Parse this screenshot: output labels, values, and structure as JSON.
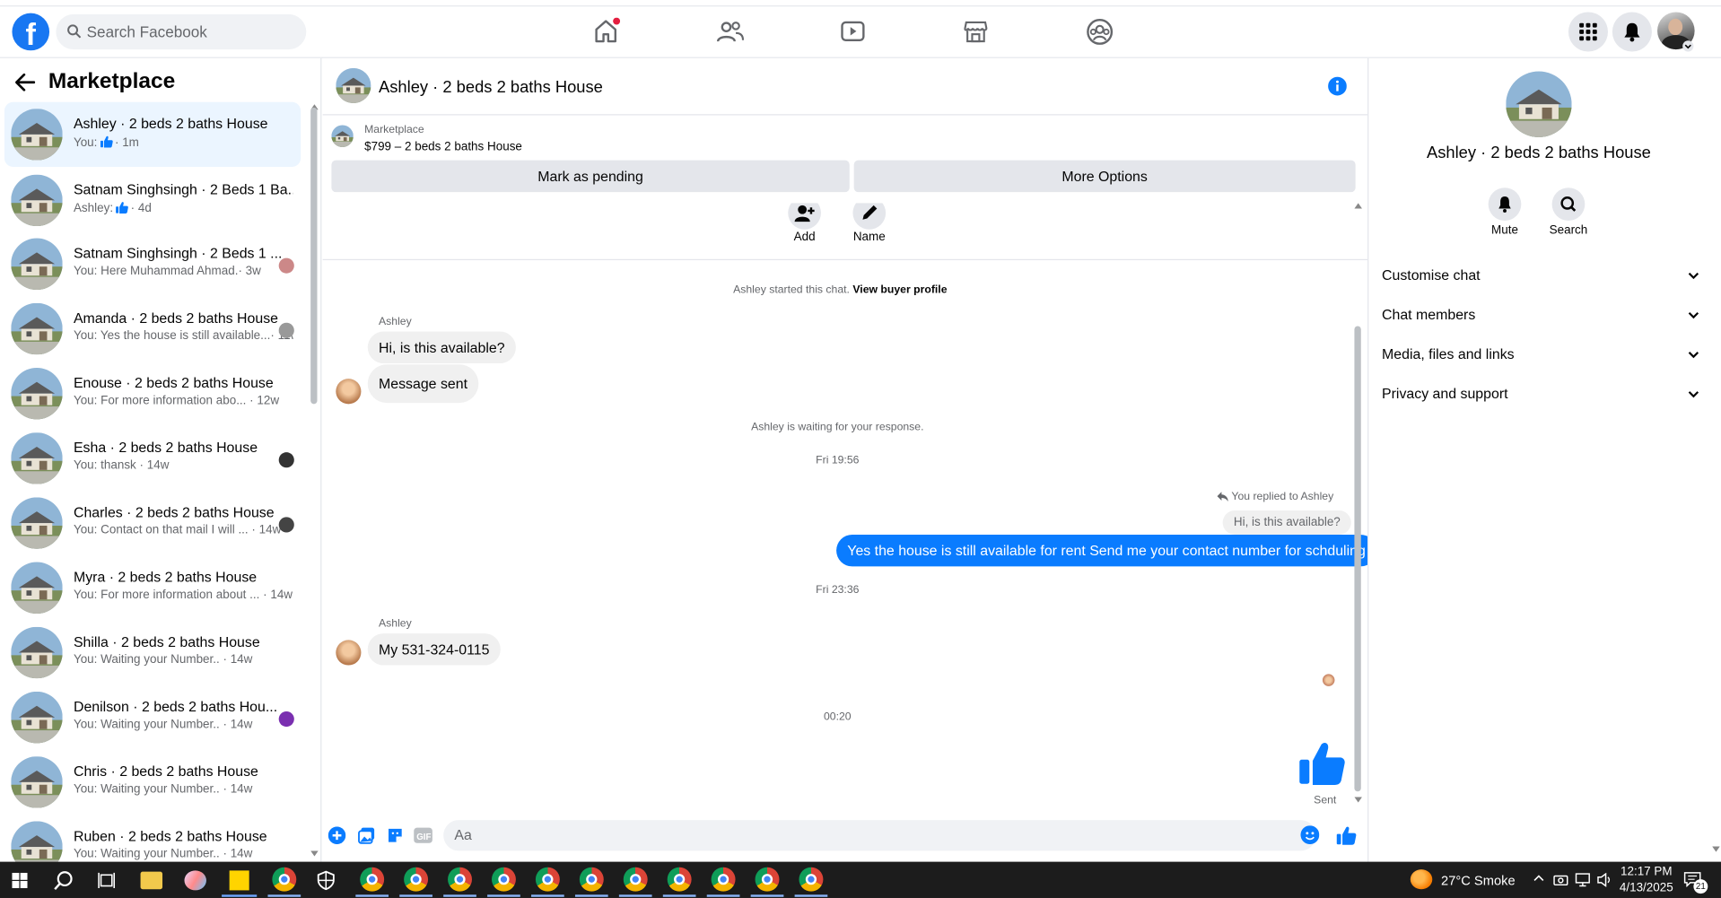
{
  "search": {
    "placeholder": "Search Facebook"
  },
  "nav": {
    "icons": [
      "home-icon",
      "friends-icon",
      "video-icon",
      "marketplace-icon",
      "groups-icon"
    ]
  },
  "left": {
    "title": "Marketplace",
    "conversations": [
      {
        "title": "Ashley · 2 beds 2 baths House",
        "sub_prefix": "You:",
        "sub": "· 1m",
        "active": true,
        "like": true
      },
      {
        "title": "Satnam Singhsingh · 2 Beds 1 Ba...",
        "sub_prefix": "Ashley:",
        "sub": "· 4d",
        "like": true
      },
      {
        "title": "Satnam Singhsingh · 2 Beds 1 ...",
        "sub": "You: Here Muhammad Ahmad.· 3w"
      },
      {
        "title": "Amanda · 2 beds 2 baths House",
        "sub": "You: Yes the house is still available...· 11w"
      },
      {
        "title": "Enouse · 2 beds 2 baths House",
        "sub": "You: For more information abo... · 12w"
      },
      {
        "title": "Esha · 2 beds 2 baths House",
        "sub": "You: thansk · 14w"
      },
      {
        "title": "Charles · 2 beds 2 baths House",
        "sub": "You: Contact on that mail I will ... · 14w"
      },
      {
        "title": "Myra · 2 beds 2 baths House",
        "sub": "You: For more information about ... · 14w"
      },
      {
        "title": "Shilla · 2 beds 2 baths House",
        "sub": "You: Waiting your Number.. · 14w"
      },
      {
        "title": "Denilson · 2 beds 2 baths Hou...",
        "sub": "You: Waiting your Number.. · 14w"
      },
      {
        "title": "Chris · 2 beds 2 baths House",
        "sub": "You: Waiting your Number.. · 14w"
      },
      {
        "title": "Ruben · 2 beds 2 baths House",
        "sub": "You: Waiting your Number.. · 14w"
      }
    ]
  },
  "chat": {
    "title": "Ashley · 2 beds 2 baths House",
    "listing_label": "Marketplace",
    "listing_price": "$799 – 2 beds 2 baths House",
    "mark_pending": "Mark as pending",
    "more_options": "More Options",
    "add_label": "Add",
    "name_label": "Name",
    "started_text": "Ashley started this chat.",
    "view_profile": "View buyer profile",
    "sender1": "Ashley",
    "msg1": "Hi, is this available?",
    "msg2": "Message sent",
    "waiting": "Ashley is waiting for your response.",
    "time1": "Fri 19:56",
    "replied_to": "You replied to Ashley",
    "quoted": "Hi, is this available?",
    "reply": "Yes the house is still available for rent Send me your contact number for schduling",
    "time2": "Fri 23:36",
    "sender2": "Ashley",
    "msg3": "My 531-324-0115",
    "time3": "00:20",
    "sent_label": "Sent",
    "input_placeholder": "Aa"
  },
  "right": {
    "title": "Ashley · 2 beds 2 baths House",
    "mute": "Mute",
    "search": "Search",
    "sections": [
      "Customise chat",
      "Chat members",
      "Media, files and links",
      "Privacy and support"
    ]
  },
  "taskbar": {
    "weather": "27°C  Smoke",
    "time": "12:17 PM",
    "date": "4/13/2025",
    "notifications": "21"
  },
  "colors": {
    "accent": "#0a7cff",
    "brand": "#1877f2",
    "active_row": "#ebf5ff"
  }
}
